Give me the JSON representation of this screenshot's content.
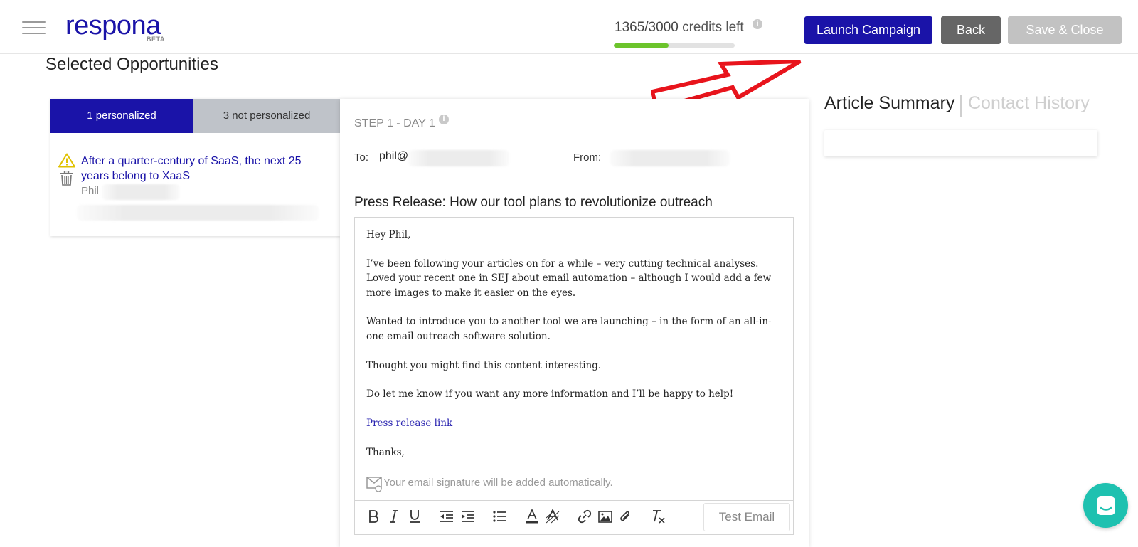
{
  "header": {
    "logo_text": "respona",
    "logo_badge": "BETA",
    "credits_used": "1365/3000",
    "credits_suffix": "credits left",
    "credits_fraction": 0.455,
    "launch_label": "Launch Campaign",
    "back_label": "Back",
    "save_close_label": "Save & Close"
  },
  "opportunities": {
    "title": "Selected Opportunities",
    "tab_personalized": "1 personalized",
    "tab_not_personalized": "3 not personalized",
    "item_title": "After a quarter-century of SaaS, the next 25 years belong to XaaS",
    "item_name": "Phil"
  },
  "email": {
    "step_label": "STEP 1 - DAY 1",
    "to_label": "To:",
    "to_value": "phil@",
    "from_label": "From:",
    "subject": "Press Release: How our tool plans to revolutionize outreach",
    "greeting": "Hey Phil,",
    "paragraph1": "I’ve been following your articles on  for a while – very cutting technical analyses. Loved your recent one in SEJ about email automation – although I would add a few more images to make it easier on the eyes.",
    "paragraph2": "Wanted to introduce you to another tool we are launching – in the form of an all-in-one email outreach software solution.",
    "paragraph3": "Thought you might find this content interesting.",
    "paragraph4": "Do let me know if you want any more information and I’ll be happy to help!",
    "link_text": "Press release link",
    "closing": "Thanks,",
    "signature_note": "Your email signature will be added automatically.",
    "test_email_label": "Test Email"
  },
  "right_panel": {
    "tab_article": "Article Summary",
    "tab_history": "Contact History"
  },
  "colors": {
    "brand": "#1a13a8",
    "progress": "#6cc42c",
    "arrow": "#e8141c",
    "chat": "#1ec1b0"
  }
}
